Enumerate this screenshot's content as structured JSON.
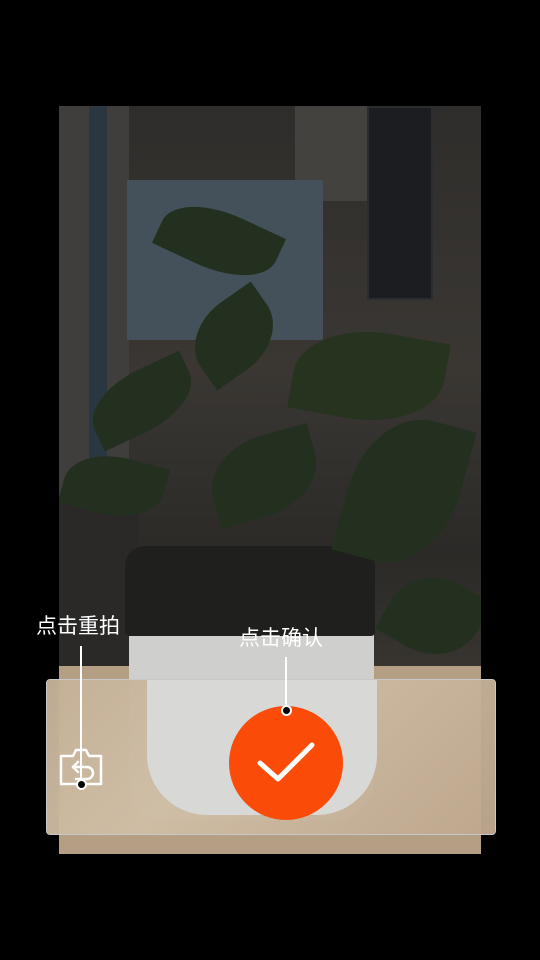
{
  "hints": {
    "retake_label": "点击重拍",
    "confirm_label": "点击确认"
  },
  "icons": {
    "retake": "camera-retake-icon",
    "confirm": "checkmark-icon"
  },
  "colors": {
    "confirm_button": "#fa4c08",
    "background": "#000000",
    "hint_text": "#ffffff"
  }
}
